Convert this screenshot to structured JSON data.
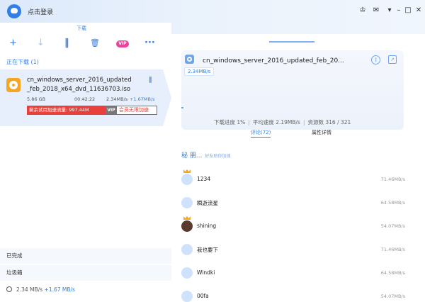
{
  "app": {
    "login": "点击登录",
    "window_icons": [
      "shirt-icon",
      "mail-icon",
      "menu-icon",
      "minimize-icon",
      "maximize-icon",
      "close-icon"
    ]
  },
  "left": {
    "tab": "下载",
    "toolbar": {
      "icons": [
        "add-icon",
        "arrow-down-icon",
        "pause-icon",
        "trash-icon",
        "more-icon"
      ],
      "vip": "VIP"
    },
    "section_title": "正在下载 (1)",
    "item": {
      "name": "cn_windows_server_2016_updated_feb_2018_x64_dvd_11636703.iso",
      "size": "5.86 GB",
      "time": "00:42:22",
      "speed": "2.34MB/s",
      "extra": "+1.67MB/s",
      "boost_text": "剩余试用加速流量: 997.44M",
      "vip_badge": "VIP",
      "vip_cta": "会员无限加速",
      "progress": 0.01
    },
    "done": "已完成",
    "trash": "垃圾箱",
    "footer": {
      "speed": "2.34 MB/s",
      "extra": "+1.67 MB/s"
    }
  },
  "detail": {
    "title": "cn_windows_server_2016_updated_feb_20...",
    "speed": "2.34MB/s",
    "progress_label": "下载进度 1%",
    "avg_label": "平均速度 2.19MB/s",
    "res_label": "资源数 316 / 321",
    "tabs": [
      "评论(72)",
      "属性详情"
    ],
    "peer_header": "秘 朋...",
    "peer_sub": "好友助你加速",
    "peers": [
      {
        "name": "1234",
        "speed": "71.46MB/s",
        "crown": true,
        "dark": false
      },
      {
        "name": "瞬逝流星",
        "speed": "64.58MB/s",
        "crown": false,
        "dark": false
      },
      {
        "name": "shining",
        "speed": "54.07MB/s",
        "crown": true,
        "dark": true
      },
      {
        "name": "我也要下",
        "speed": "71.46MB/s",
        "crown": false,
        "dark": false
      },
      {
        "name": "Windki",
        "speed": "64.58MB/s",
        "crown": false,
        "dark": false
      },
      {
        "name": "00fa",
        "speed": "54.07MB/s",
        "crown": false,
        "dark": false
      }
    ]
  }
}
